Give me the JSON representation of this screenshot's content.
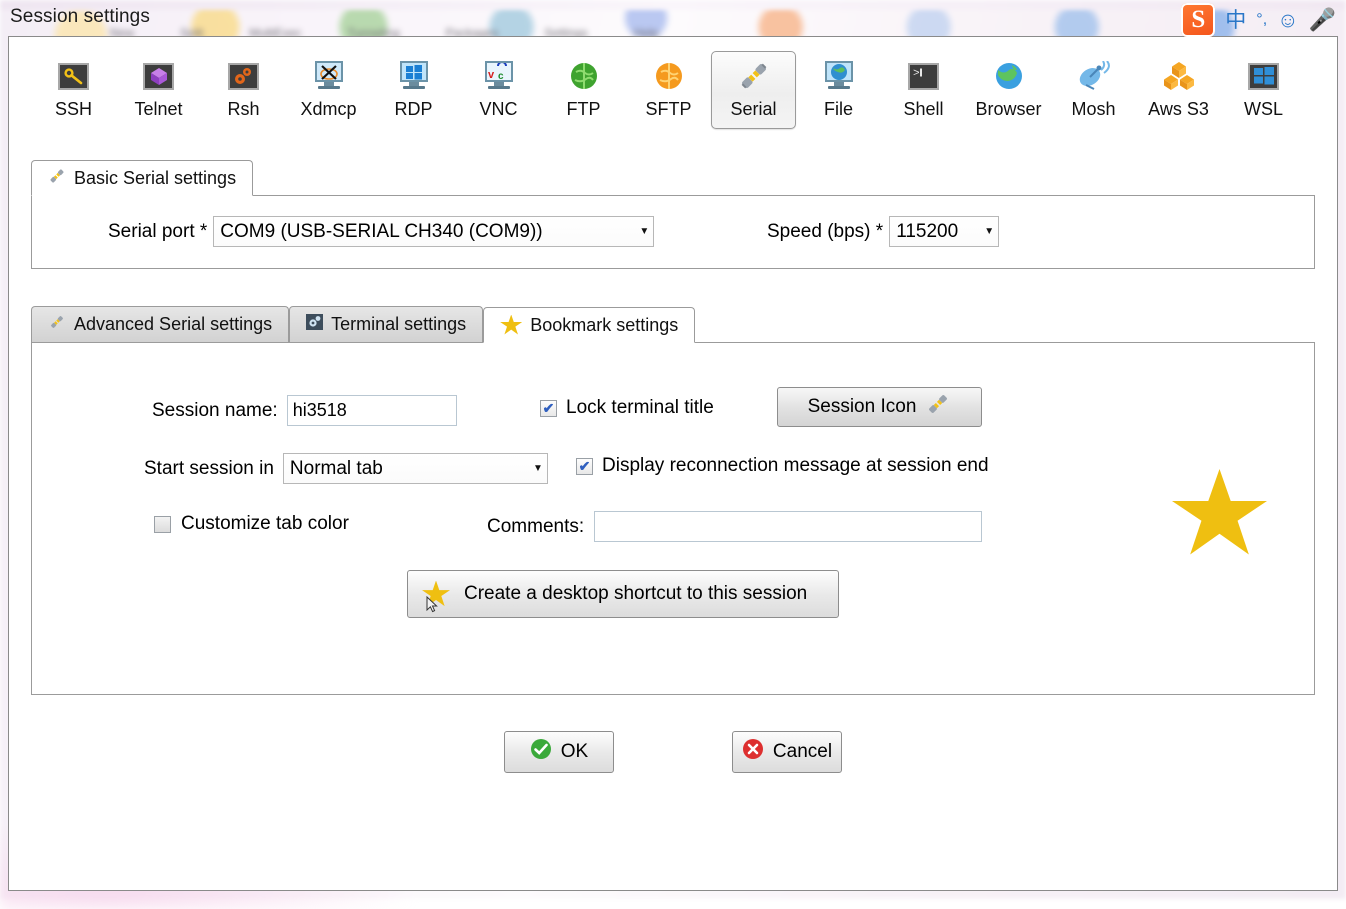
{
  "window": {
    "title": "Session settings"
  },
  "ime": {
    "brand": "S",
    "mode_label": "中",
    "punctuation_label": "°,",
    "emoji_icon": "smiley-icon",
    "mic_icon": "microphone-icon"
  },
  "backdrop_labels": [
    "New",
    "Split",
    "MultiExec",
    "Tunneling",
    "Packages",
    "Settings",
    "Help"
  ],
  "protocols": [
    {
      "label": "SSH",
      "icon": "key-icon",
      "selected": false
    },
    {
      "label": "Telnet",
      "icon": "purple-cube-icon",
      "selected": false
    },
    {
      "label": "Rsh",
      "icon": "gears-icon",
      "selected": false
    },
    {
      "label": "Xdmcp",
      "icon": "x-monitor-icon",
      "selected": false
    },
    {
      "label": "RDP",
      "icon": "windows-monitor-icon",
      "selected": false
    },
    {
      "label": "VNC",
      "icon": "vnc-monitor-icon",
      "selected": false
    },
    {
      "label": "FTP",
      "icon": "green-globe-icon",
      "selected": false
    },
    {
      "label": "SFTP",
      "icon": "orange-globe-icon",
      "selected": false
    },
    {
      "label": "Serial",
      "icon": "serial-plug-icon",
      "selected": true
    },
    {
      "label": "File",
      "icon": "globe-monitor-icon",
      "selected": false
    },
    {
      "label": "Shell",
      "icon": "terminal-prompt-icon",
      "selected": false
    },
    {
      "label": "Browser",
      "icon": "globe-icon",
      "selected": false
    },
    {
      "label": "Mosh",
      "icon": "satellite-dish-icon",
      "selected": false
    },
    {
      "label": "Aws S3",
      "icon": "aws-cubes-icon",
      "selected": false
    },
    {
      "label": "WSL",
      "icon": "windows-logo-icon",
      "selected": false
    }
  ],
  "basic_panel": {
    "tab_label": "Basic Serial settings",
    "tab_icon": "serial-plug-icon",
    "serial_port_label": "Serial port *",
    "serial_port_value": "COM9  (USB-SERIAL CH340 (COM9))",
    "speed_label": "Speed (bps) *",
    "speed_value": "115200"
  },
  "sub_tabs": [
    {
      "label": "Advanced Serial settings",
      "icon": "serial-plug-icon",
      "active": false
    },
    {
      "label": "Terminal settings",
      "icon": "terminal-gear-icon",
      "active": false
    },
    {
      "label": "Bookmark settings",
      "icon": "star-icon",
      "active": true
    }
  ],
  "bookmark_panel": {
    "session_name_label": "Session name:",
    "session_name_value": "hi3518",
    "session_name_placeholder": "",
    "lock_terminal_label": "Lock terminal title",
    "lock_terminal_checked": true,
    "session_icon_button": "Session Icon",
    "session_icon_button_icon": "serial-plug-icon",
    "start_session_label": "Start session in",
    "start_session_value": "Normal tab",
    "display_reconnect_label": "Display reconnection message at session end",
    "display_reconnect_checked": true,
    "customize_tab_color_label": "Customize tab color",
    "customize_tab_color_checked": false,
    "comments_label": "Comments:",
    "comments_value": "",
    "comments_placeholder": "",
    "shortcut_button": "Create a desktop shortcut to this session",
    "shortcut_button_icon": "star-icon",
    "decorative_star_icon": "star-icon"
  },
  "footer": {
    "ok_label": "OK",
    "ok_icon": "green-check-icon",
    "cancel_label": "Cancel",
    "cancel_icon": "red-x-icon"
  },
  "colors": {
    "star_gold": "#efbf11",
    "ok_green": "#3aa93a",
    "cancel_red": "#dd2f2f",
    "checkbox_blue": "#2f5fbf",
    "ime_blue": "#2a77c8",
    "sogou_orange": "#f4541b",
    "dialog_border": "#8a8a8a"
  }
}
